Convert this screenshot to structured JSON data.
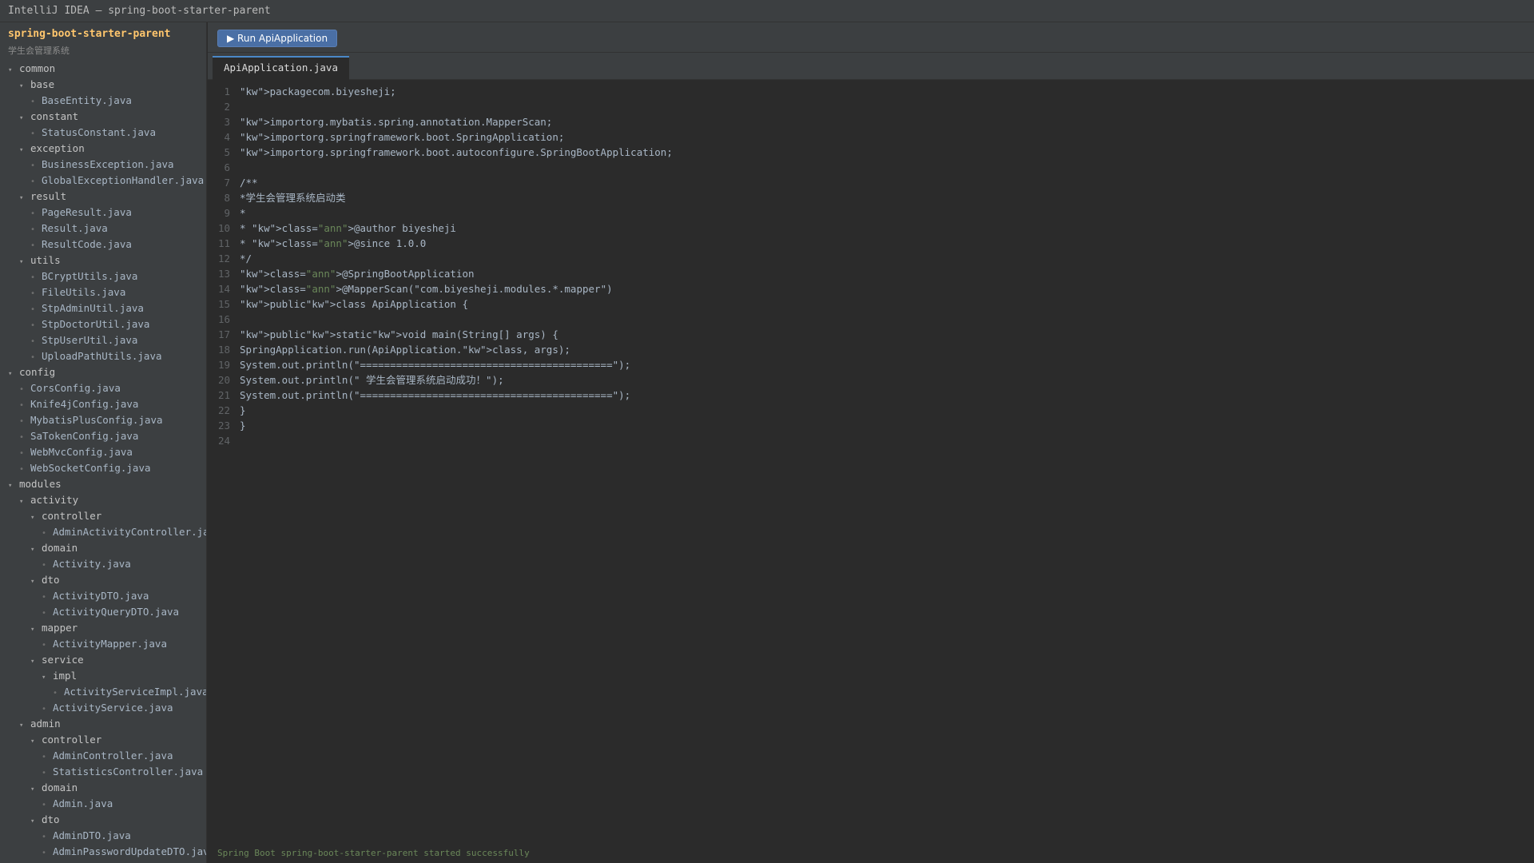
{
  "window": {
    "title": "IntelliJ IDEA — spring-boot-starter-parent"
  },
  "sidebar": {
    "project_name": "spring-boot-starter-parent",
    "project_subtitle": "学生会管理系统",
    "tree": [
      {
        "label": "common",
        "depth": 0,
        "type": "folder"
      },
      {
        "label": "base",
        "depth": 1,
        "type": "folder"
      },
      {
        "label": "BaseEntity.java",
        "depth": 2,
        "type": "file"
      },
      {
        "label": "constant",
        "depth": 1,
        "type": "folder"
      },
      {
        "label": "StatusConstant.java",
        "depth": 2,
        "type": "file"
      },
      {
        "label": "exception",
        "depth": 1,
        "type": "folder"
      },
      {
        "label": "BusinessException.java",
        "depth": 2,
        "type": "file"
      },
      {
        "label": "GlobalExceptionHandler.java",
        "depth": 2,
        "type": "file"
      },
      {
        "label": "result",
        "depth": 1,
        "type": "folder"
      },
      {
        "label": "PageResult.java",
        "depth": 2,
        "type": "file"
      },
      {
        "label": "Result.java",
        "depth": 2,
        "type": "file"
      },
      {
        "label": "ResultCode.java",
        "depth": 2,
        "type": "file"
      },
      {
        "label": "utils",
        "depth": 1,
        "type": "folder"
      },
      {
        "label": "BCryptUtils.java",
        "depth": 2,
        "type": "file"
      },
      {
        "label": "FileUtils.java",
        "depth": 2,
        "type": "file"
      },
      {
        "label": "StpAdminUtil.java",
        "depth": 2,
        "type": "file"
      },
      {
        "label": "StpDoctorUtil.java",
        "depth": 2,
        "type": "file"
      },
      {
        "label": "StpUserUtil.java",
        "depth": 2,
        "type": "file"
      },
      {
        "label": "UploadPathUtils.java",
        "depth": 2,
        "type": "file"
      },
      {
        "label": "config",
        "depth": 0,
        "type": "folder"
      },
      {
        "label": "CorsConfig.java",
        "depth": 1,
        "type": "file"
      },
      {
        "label": "Knife4jConfig.java",
        "depth": 1,
        "type": "file"
      },
      {
        "label": "MybatisPlusConfig.java",
        "depth": 1,
        "type": "file"
      },
      {
        "label": "SaTokenConfig.java",
        "depth": 1,
        "type": "file"
      },
      {
        "label": "WebMvcConfig.java",
        "depth": 1,
        "type": "file"
      },
      {
        "label": "WebSocketConfig.java",
        "depth": 1,
        "type": "file"
      },
      {
        "label": "modules",
        "depth": 0,
        "type": "folder"
      },
      {
        "label": "activity",
        "depth": 1,
        "type": "folder"
      },
      {
        "label": "controller",
        "depth": 2,
        "type": "folder"
      },
      {
        "label": "AdminActivityController.java",
        "depth": 3,
        "type": "file"
      },
      {
        "label": "domain",
        "depth": 2,
        "type": "folder"
      },
      {
        "label": "Activity.java",
        "depth": 3,
        "type": "file"
      },
      {
        "label": "dto",
        "depth": 2,
        "type": "folder"
      },
      {
        "label": "ActivityDTO.java",
        "depth": 3,
        "type": "file"
      },
      {
        "label": "ActivityQueryDTO.java",
        "depth": 3,
        "type": "file"
      },
      {
        "label": "mapper",
        "depth": 2,
        "type": "folder"
      },
      {
        "label": "ActivityMapper.java",
        "depth": 3,
        "type": "file"
      },
      {
        "label": "service",
        "depth": 2,
        "type": "folder"
      },
      {
        "label": "impl",
        "depth": 3,
        "type": "folder"
      },
      {
        "label": "ActivityServiceImpl.java",
        "depth": 4,
        "type": "file"
      },
      {
        "label": "ActivityService.java",
        "depth": 3,
        "type": "file"
      },
      {
        "label": "admin",
        "depth": 1,
        "type": "folder"
      },
      {
        "label": "controller",
        "depth": 2,
        "type": "folder"
      },
      {
        "label": "AdminController.java",
        "depth": 3,
        "type": "file"
      },
      {
        "label": "StatisticsController.java",
        "depth": 3,
        "type": "file"
      },
      {
        "label": "domain",
        "depth": 2,
        "type": "folder"
      },
      {
        "label": "Admin.java",
        "depth": 3,
        "type": "file"
      },
      {
        "label": "dto",
        "depth": 2,
        "type": "folder"
      },
      {
        "label": "AdminDTO.java",
        "depth": 3,
        "type": "file"
      },
      {
        "label": "AdminPasswordUpdateDTO.java",
        "depth": 3,
        "type": "file"
      }
    ]
  },
  "toolbar": {
    "run_label": "▶ Run ApiApplication"
  },
  "editor": {
    "active_tab": "ApiApplication.java",
    "lines": [
      "\"kw\">packagecom.biyesheji;",
      "",
      "\"kw\">importorg.mybatis.spring.annotation.MapperScan;",
      "\"kw\">importorg.springframework.boot.SpringApplication;",
      "\"kw\">importorg.springframework.boot.autoconfigure.SpringBootApplication;",
      "",
      "/**",
      "*学生会管理系统启动类",
      "*",
      "* \"kw\">class=\"ann\">@author biyesheji",
      "* \"kw\">class=\"ann\">@since 1.0.0",
      "*/",
      "\"kw\">class=\"ann\">@SpringBootApplication",
      "\"kw\">class=\"ann\">@MapperScan(\"com.biyesheji.modules.*.mapper\")",
      "\"kw\">public\"kw\">class ApiApplication {",
      "",
      "\"kw\">public\"kw\">static\"kw\">void main(String[] args) {",
      "SpringApplication.run(ApiApplication.\"kw\">class, args);",
      "System.out.println(\"==========================================\");",
      "System.out.println(\" 学生会管理系统启动成功！\");",
      "System.out.println(\"==========================================\");",
      "}",
      "}",
      ""
    ]
  },
  "status": {
    "message": "Spring Boot spring-boot-starter-parent started successfully"
  },
  "colors": {
    "background": "#2b2b2b",
    "panel": "#3c3f41",
    "accent_orange": "#ffc66d",
    "run_button": "#4a6fa5",
    "string_green": "#6a8759",
    "line_number": "#606366"
  }
}
